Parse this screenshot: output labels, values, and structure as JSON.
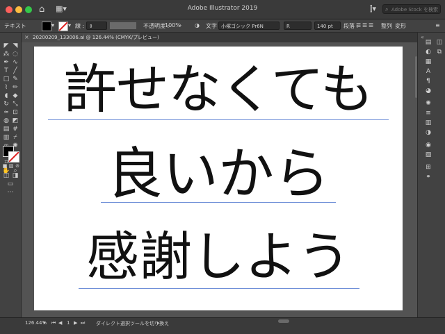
{
  "window": {
    "title": "Adobe Illustrator 2019"
  },
  "search": {
    "placeholder": "Adobe Stock を検索"
  },
  "control_bar": {
    "mode_label": "テキスト",
    "stroke_label": "線 :",
    "opacity_label": "不透明度 :",
    "opacity_value": "100%",
    "character_label": "文字 :",
    "font_family": "小塚ゴシック Pr6N",
    "font_style": "R",
    "font_size": "140 pt",
    "paragraph_label": "段落 :",
    "align_label": "整列",
    "transform_label": "変形"
  },
  "document": {
    "tab_label": "20200209_133006.ai @ 126.44% (CMYK/プレビュー)",
    "lines": [
      "許せなくても",
      "良いから",
      "感謝しよう"
    ]
  },
  "status_bar": {
    "zoom": "126.44%",
    "page": "1",
    "tool_hint": "ダイレクト選択ツールを切り換え"
  },
  "colors": {
    "fill": "#000000",
    "stroke": "none",
    "guide": "#6f8fd8",
    "artboard": "#ffffff",
    "ui_bg": "#535353"
  }
}
